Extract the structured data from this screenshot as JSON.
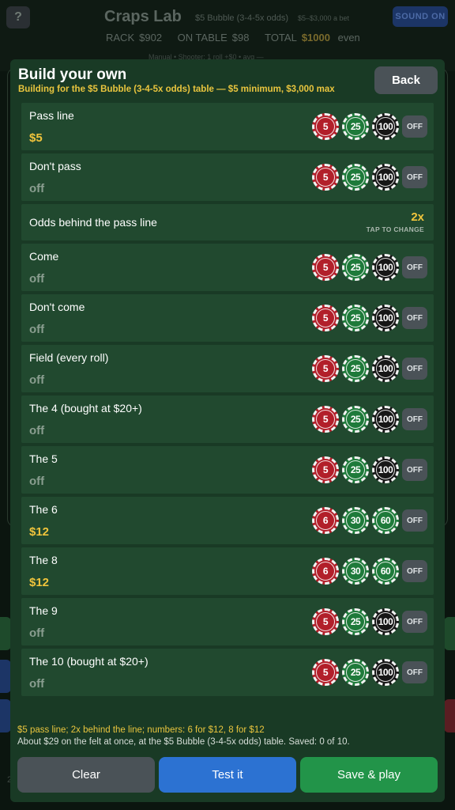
{
  "background": {
    "help_label": "?",
    "app_title": "Craps Lab",
    "table_name": "$5 Bubble (3-4-5x odds)",
    "table_range": "$5–$3,000 a bet",
    "sound_label": "SOUND  ON",
    "rack_label": "RACK",
    "rack_value": "$902",
    "on_table_label": "ON TABLE",
    "on_table_value": "$98",
    "total_label": "TOTAL",
    "total_value": "$1000",
    "even_label": "even",
    "sub_status": "Manual  •  Shooter: 1 roll  +$0  •  avg —",
    "bottom_fragment": "2"
  },
  "modal": {
    "title": "Build your own",
    "subtitle": "Building for the $5 Bubble (3-4-5x odds) table — $5 minimum, $3,000 max",
    "back_label": "Back",
    "odds_row": {
      "label": "Odds behind the pass line",
      "value": "2x",
      "hint": "TAP TO CHANGE"
    },
    "off_label": "OFF",
    "rows": [
      {
        "label": "Pass line",
        "value": "$5",
        "chips": [
          "5",
          "25",
          "100"
        ]
      },
      {
        "label": "Don't pass",
        "value": "off",
        "chips": [
          "5",
          "25",
          "100"
        ]
      },
      {
        "label": "Come",
        "value": "off",
        "chips": [
          "5",
          "25",
          "100"
        ]
      },
      {
        "label": "Don't come",
        "value": "off",
        "chips": [
          "5",
          "25",
          "100"
        ]
      },
      {
        "label": "Field (every roll)",
        "value": "off",
        "chips": [
          "5",
          "25",
          "100"
        ]
      },
      {
        "label": "The 4  (bought at $20+)",
        "value": "off",
        "chips": [
          "5",
          "25",
          "100"
        ]
      },
      {
        "label": "The 5",
        "value": "off",
        "chips": [
          "5",
          "25",
          "100"
        ]
      },
      {
        "label": "The 6",
        "value": "$12",
        "chips": [
          "6",
          "30",
          "60"
        ]
      },
      {
        "label": "The 8",
        "value": "$12",
        "chips": [
          "6",
          "30",
          "60"
        ]
      },
      {
        "label": "The 9",
        "value": "off",
        "chips": [
          "5",
          "25",
          "100"
        ]
      },
      {
        "label": "The 10  (bought at $20+)",
        "value": "off",
        "chips": [
          "5",
          "25",
          "100"
        ]
      }
    ],
    "summary_line1": "$5 pass line; 2x behind the line; numbers: 6 for $12, 8 for $12",
    "summary_line2": "About $29 on the felt at once, at the $5 Bubble (3-4-5x odds) table.  Saved: 0 of 10.",
    "clear_label": "Clear",
    "test_label": "Test it",
    "save_label": "Save & play"
  },
  "colors": {
    "modal_bg": "#193a25",
    "row_bg": "#21492f",
    "gold": "#f0c43c",
    "chip_red": "#b21f2a",
    "chip_green": "#1e7a3a",
    "chip_black": "#161616",
    "test_blue": "#2c72d2",
    "save_green": "#229449",
    "neutral_btn": "#4a5257"
  }
}
